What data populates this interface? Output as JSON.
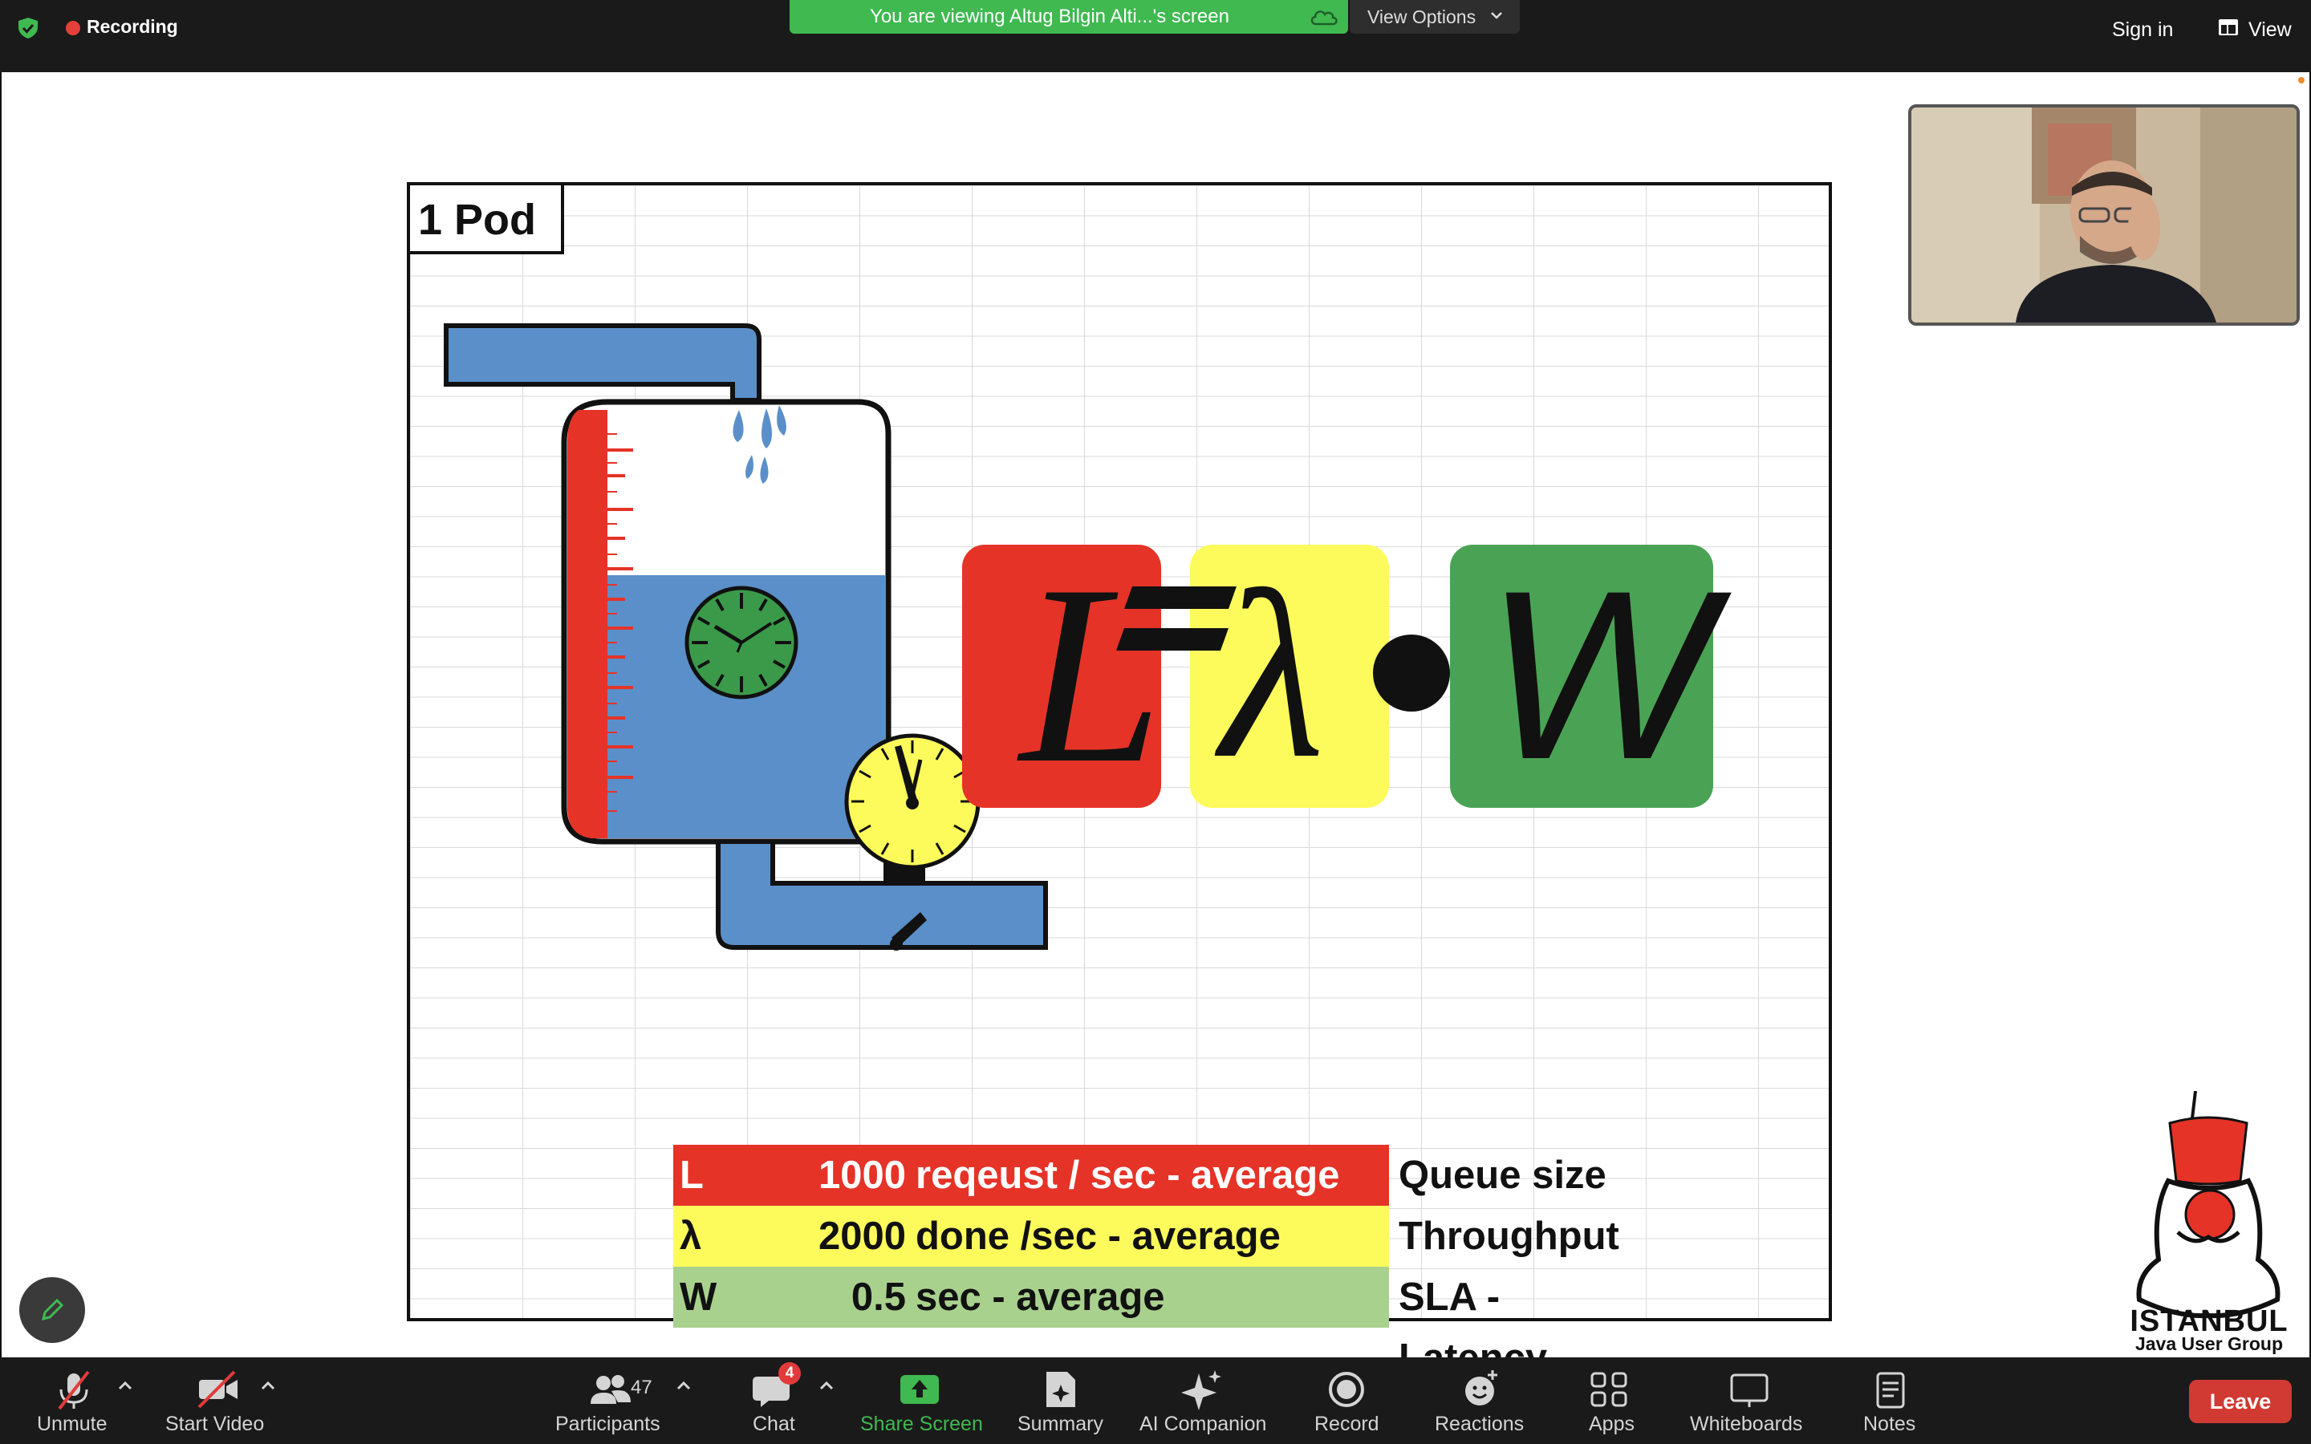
{
  "topbar": {
    "recording_label": "Recording",
    "viewing_text": "You are viewing Altug Bilgin Alti...'s screen",
    "view_options_label": "View Options",
    "sign_in_label": "Sign in",
    "view_label": "View",
    "colors": {
      "viewing_banner": "#3fb950",
      "recording_dot": "#e5403a"
    }
  },
  "slide": {
    "pod_label": "1 Pod",
    "equation": {
      "l": "L",
      "lambda": "λ",
      "w": "W"
    },
    "legend": [
      {
        "symbol": "L",
        "number": "1000",
        "description": "reqeust / sec - average",
        "meaning": "Queue size",
        "color": "#e53328"
      },
      {
        "symbol": "λ",
        "number": "2000",
        "description": "done /sec - average",
        "meaning": "Throughput",
        "color": "#fdfb5b"
      },
      {
        "symbol": "W",
        "number": "0.5",
        "description": "sec  - average",
        "meaning": "SLA - Latency",
        "color": "#a9d18e"
      }
    ]
  },
  "logo": {
    "title": "ISTANBUL",
    "subtitle": "Java User Group"
  },
  "toolbar": {
    "unmute_label": "Unmute",
    "start_video_label": "Start Video",
    "participants_label": "Participants",
    "participants_count": "47",
    "chat_label": "Chat",
    "chat_badge": "4",
    "share_screen_label": "Share Screen",
    "summary_label": "Summary",
    "ai_companion_label": "AI Companion",
    "record_label": "Record",
    "reactions_label": "Reactions",
    "apps_label": "Apps",
    "whiteboards_label": "Whiteboards",
    "notes_label": "Notes",
    "leave_label": "Leave",
    "colors": {
      "share_green": "#3fb950",
      "leave_red": "#d13a32"
    }
  }
}
